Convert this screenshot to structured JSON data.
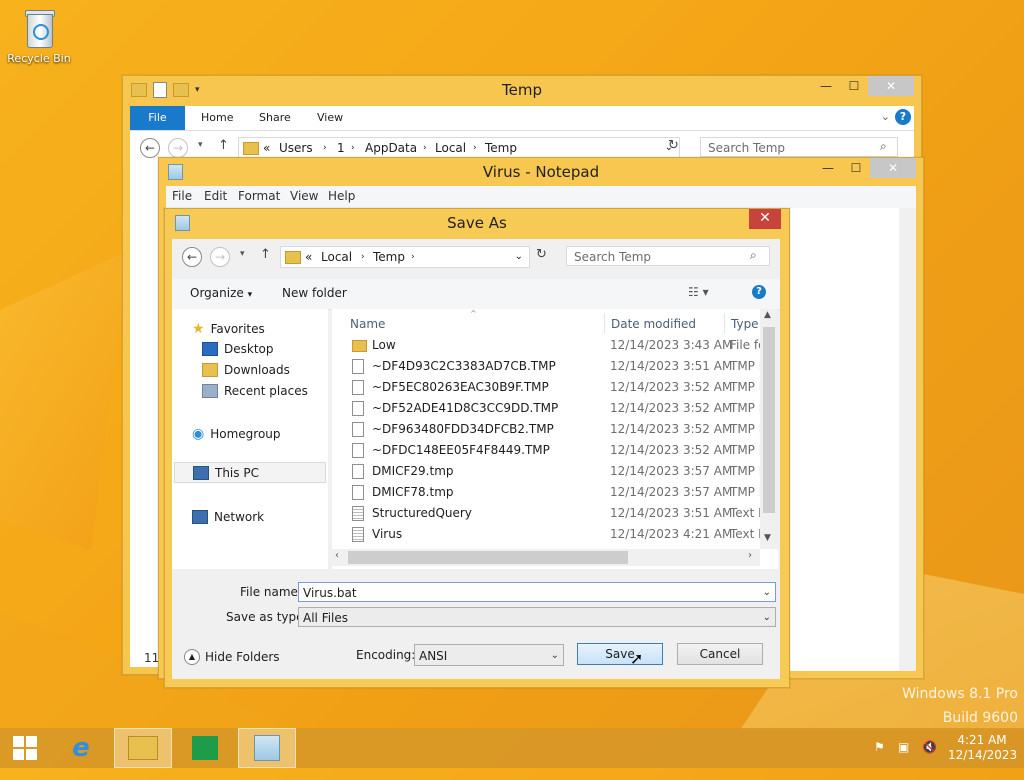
{
  "desktop": {
    "recycle_bin_label": "Recycle Bin",
    "watermark_line1": "Windows 8.1 Pro",
    "watermark_line2": "Build 9600"
  },
  "explorer": {
    "title": "Temp",
    "tabs": [
      "File",
      "Home",
      "Share",
      "View"
    ],
    "address": [
      "«",
      "Users",
      "1",
      "AppData",
      "Local",
      "Temp"
    ],
    "search_placeholder": "Search Temp",
    "status_count": "11"
  },
  "notepad": {
    "title": "Virus - Notepad",
    "menu": [
      "File",
      "Edit",
      "Format",
      "View",
      "Help"
    ]
  },
  "saveas": {
    "title": "Save As",
    "address": [
      "«",
      "Local",
      "Temp"
    ],
    "search_placeholder": "Search Temp",
    "organize_label": "Organize",
    "new_folder_label": "New folder",
    "nav": {
      "favorites": "Favorites",
      "desktop": "Desktop",
      "downloads": "Downloads",
      "recent": "Recent places",
      "homegroup": "Homegroup",
      "thispc": "This PC",
      "network": "Network"
    },
    "columns": [
      "Name",
      "Date modified",
      "Type"
    ],
    "files": [
      {
        "name": "Low",
        "date": "12/14/2023 3:43 AM",
        "type": "File folder",
        "icon": "folder"
      },
      {
        "name": "~DF4D93C2C3383AD7CB.TMP",
        "date": "12/14/2023 3:51 AM",
        "type": "TMP File",
        "icon": "file"
      },
      {
        "name": "~DF5EC80263EAC30B9F.TMP",
        "date": "12/14/2023 3:52 AM",
        "type": "TMP File",
        "icon": "file"
      },
      {
        "name": "~DF52ADE41D8C3CC9DD.TMP",
        "date": "12/14/2023 3:52 AM",
        "type": "TMP File",
        "icon": "file"
      },
      {
        "name": "~DF963480FDD34DFCB2.TMP",
        "date": "12/14/2023 3:52 AM",
        "type": "TMP File",
        "icon": "file"
      },
      {
        "name": "~DFDC148EE05F4F8449.TMP",
        "date": "12/14/2023 3:52 AM",
        "type": "TMP File",
        "icon": "file"
      },
      {
        "name": "DMICF29.tmp",
        "date": "12/14/2023 3:57 AM",
        "type": "TMP File",
        "icon": "file"
      },
      {
        "name": "DMICF78.tmp",
        "date": "12/14/2023 3:57 AM",
        "type": "TMP File",
        "icon": "file"
      },
      {
        "name": "StructuredQuery",
        "date": "12/14/2023 3:51 AM",
        "type": "Text Document",
        "icon": "doc"
      },
      {
        "name": "Virus",
        "date": "12/14/2023 4:21 AM",
        "type": "Text Document",
        "icon": "doc"
      }
    ],
    "filename_label": "File name:",
    "filename_value": "Virus.bat",
    "savetype_label": "Save as type:",
    "savetype_value": "All Files",
    "hide_folders_label": "Hide Folders",
    "encoding_label": "Encoding:",
    "encoding_value": "ANSI",
    "save_label": "Save",
    "cancel_label": "Cancel"
  },
  "taskbar": {
    "time": "4:21 AM",
    "date": "12/14/2023"
  },
  "colors": {
    "accent": "#1979ca",
    "desktop": "#f5a818",
    "close_red": "#c7433b"
  }
}
